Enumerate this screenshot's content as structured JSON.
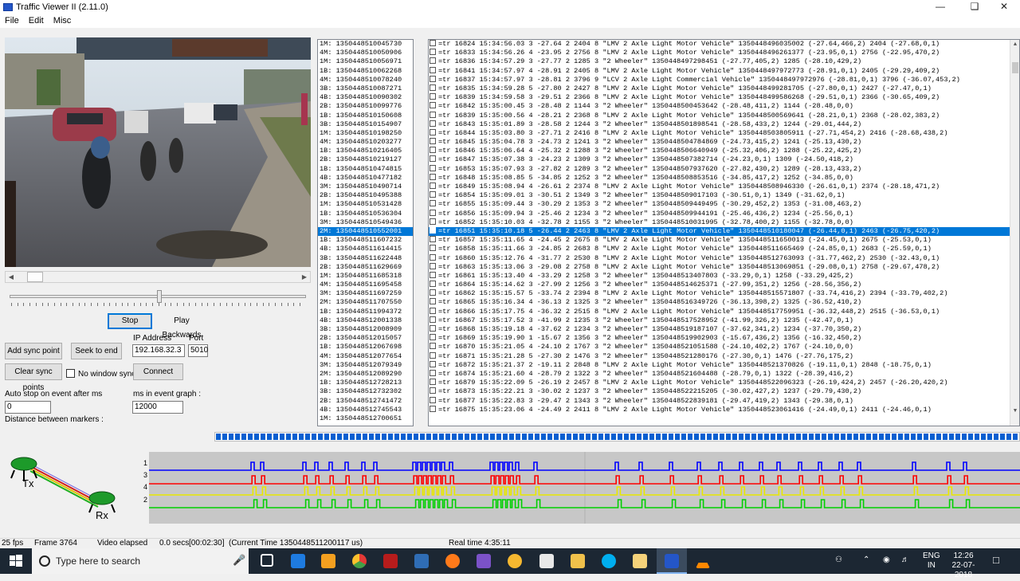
{
  "window": {
    "title": "Traffic Viewer II (2.11.0)",
    "min_icon": "minimize-icon",
    "max_icon": "maximize-icon",
    "close_icon": "close-icon"
  },
  "menu": [
    "File",
    "Edit",
    "Misc"
  ],
  "controls": {
    "stop": "Stop",
    "play_backwards": "Play Backwards",
    "add_sync": "Add sync point",
    "seek_end": "Seek to end",
    "clear_sync": "Clear sync points",
    "no_window_sync": "No window sync",
    "connect": "Connect",
    "ip_label": "IP Address",
    "ip_value": "192.168.32.3",
    "port_label": "Port",
    "port_value": "5010",
    "auto_stop_label": "Auto stop on event after ms",
    "auto_stop_value": "0",
    "ms_graph_label": "ms in event graph :",
    "ms_graph_value": "12000",
    "distance_label": "Distance between markers :"
  },
  "timestamps": [
    "1M:  1350448510045730",
    "4M:  1350448510050906",
    "1M:  1350448510056971",
    "1B:  1350448510062268",
    "4M:  1350448510078240",
    "3B:  1350448510087271",
    "4B:  1350448510090302",
    "2B:  1350448510099776",
    "1B:  1350448510150608",
    "3B:  1350448510154907",
    "1M:  1350448510198250",
    "4M:  1350448510203277",
    "1B:  1350448510216405",
    "2B:  1350448510219127",
    "1B:  1350448510474815",
    "4B:  1350448510477182",
    "3M:  1350448510490714",
    "2B:  1350448510495388",
    "1M:  1350448510531428",
    "1B:  1350448510536304",
    "3M:  1350448510549436",
    "2M:  1350448510552001",
    "1B:  1350448511607232",
    "4B:  1350448511614415",
    "3B:  1350448511622448",
    "2B:  1350448511629669",
    "1M:  1350448511685318",
    "4M:  1350448511695458",
    "3M:  1350448511697259",
    "2M:  1350448511707550",
    "1B:  1350448511994372",
    "4B:  1350448512001338",
    "3B:  1350448512008909",
    "2B:  1350448512015057",
    "1B:  1350448512067698",
    "4M:  1350448512077654",
    "3M:  1350448512079349",
    "2M:  1350448512089290",
    "1B:  1350448512728213",
    "3B:  1350448512732302",
    "2B:  1350448512741472",
    "4B:  1350448512745543",
    "1M:  1350448512700651"
  ],
  "timestamps_selected": 21,
  "events": [
    "=tr 16824 15:34:56.03 3 -27.64 2 2404 8 \"LMV 2 Axle Light Motor Vehicle\" 1350448496035002 (-27.64,466,2) 2404 (-27.68,0,1)",
    "=tr 16833 15:34:56.26 4 -23.95 2 2756 8 \"LMV 2 Axle Light Motor Vehicle\" 1350448496261377 (-23.95,0,1) 2756 (-22.95,470,2)",
    "=tr 16836 15:34:57.29 3 -27.77 2 1285 3 \"2 Wheeler\" 1350448497298451 (-27.77,405,2) 1285 (-28.10,429,2)",
    "=tr 16841 15:34:57.97 4 -28.91 2 2405 8 \"LMV 2 Axle Light Motor Vehicle\" 1350448497972773 (-28.91,0,1) 2405 (-29.29,409,2)",
    "=tr 16837 15:34:57.97 3 -28.81 2 3796 9 \"LCV 2 Axle Light Commercial Vehicle\" 1350448497972976 (-28.81,0,1) 3796 (-36.07,453,2)",
    "=tr 16835 15:34:59.28 5 -27.80 2 2427 8 \"LMV 2 Axle Light Motor Vehicle\" 1350448499281705 (-27.80,0,1) 2427 (-27.47,0,1)",
    "=tr 16839 15:34:59.58 3 -29.51 2 2366 8 \"LMV 2 Axle Light Motor Vehicle\" 1350448499586268 (-29.51,0,1) 2366 (-30.65,409,2)",
    "=tr 16842 15:35:00.45 3 -28.48 2 1144 3 \"2 Wheeler\" 1350448500453642 (-28.48,411,2) 1144 (-28.48,0,0)",
    "=tr 16839 15:35:00.56 4 -28.21 2 2368 8 \"LMV 2 Axle Light Motor Vehicle\" 1350448500569641 (-28.21,0,1) 2368 (-28.02,383,2)",
    "=tr 16843 15:35:01.89 3 -28.58 2 1244 3 \"2 Wheeler\" 1350448501898541 (-28.58,433,2) 1244 (-29.01,444,2)",
    "=tr 16844 15:35:03.80 3 -27.71 2 2416 8 \"LMV 2 Axle Light Motor Vehicle\" 1350448503805911 (-27.71,454,2) 2416 (-28.68,438,2)",
    "=tr 16845 15:35:04.78 3 -24.73 2 1241 3 \"2 Wheeler\" 1350448504784869 (-24.73,415,2) 1241 (-25.13,430,2)",
    "=tr 16846 15:35:06.64 4 -25.32 2 1288 3 \"2 Wheeler\" 1350448506640949 (-25.32,406,2) 1288 (-25.22,425,2)",
    "=tr 16847 15:35:07.38 3 -24.23 2 1309 3 \"2 Wheeler\" 1350448507382714 (-24.23,0,1) 1309 (-24.50,418,2)",
    "=tr 16853 15:35:07.93 3 -27.82 2 1289 3 \"2 Wheeler\" 1350448507937620 (-27.82,430,2) 1289 (-28.13,433,2)",
    "=tr 16848 15:35:08.85 5 -34.85 2 1252 3 \"2 Wheeler\" 1350448508853516 (-34.85,417,2) 1252 (-34.85,0,0)",
    "=tr 16849 15:35:08.94 4 -26.61 2 2374 8 \"LMV 2 Axle Light Motor Vehicle\" 1350448508946330 (-26.61,0,1) 2374 (-28.18,471,2)",
    "=tr 16854 15:35:09.01 3 -30.51 2 1349 3 \"2 Wheeler\" 1350448509017103 (-30.51,0,1) 1349 (-31.62,0,1)",
    "=tr 16855 15:35:09.44 3 -30.29 2 1353 3 \"2 Wheeler\" 1350448509449495 (-30.29,452,2) 1353 (-31.08,463,2)",
    "=tr 16856 15:35:09.94 3 -25.46 2 1234 3 \"2 Wheeler\" 1350448509944191 (-25.46,436,2) 1234 (-25.56,0,1)",
    "=tr 16852 15:35:10.03 4 -32.78 2 1155 3 \"2 Wheeler\" 1350448510031995 (-32.78,400,2) 1155 (-32.78,0,0)",
    "=tr 16851 15:35:10.18 5 -26.44 2 2463 8 \"LMV 2 Axle Light Motor Vehicle\" 1350448510180047 (-26.44,0,1) 2463 (-26.75,420,2)",
    "=tr 16857 15:35:11.65 4 -24.45 2 2675 8 \"LMV 2 Axle Light Motor Vehicle\" 1350448511650013 (-24.45,0,1) 2675 (-25.53,0,1)",
    "=tr 16858 15:35:11.66 3 -24.85 2 2683 8 \"LMV 2 Axle Light Motor Vehicle\" 1350448511665469 (-24.85,0,1) 2683 (-25.59,0,1)",
    "=tr 16860 15:35:12.76 4 -31.77 2 2530 8 \"LMV 2 Axle Light Motor Vehicle\" 1350448512763093 (-31.77,462,2) 2530 (-32.43,0,1)",
    "=tr 16863 15:35:13.06 3 -29.08 2 2758 8 \"LMV 2 Axle Light Motor Vehicle\" 1350448513069851 (-29.08,0,1) 2758 (-29.67,478,2)",
    "=tr 16861 15:35:13.40 4 -33.29 2 1258 3 \"2 Wheeler\" 1350448513407803 (-33.29,0,1) 1258 (-33.29,425,2)",
    "=tr 16864 15:35:14.62 3 -27.99 2 1256 3 \"2 Wheeler\" 1350448514625371 (-27.99,351,2) 1256 (-28.56,356,2)",
    "=tr 16862 15:35:15.57 5 -33.74 2 2394 8 \"LMV 2 Axle Light Motor Vehicle\" 1350448515571807 (-33.74,416,2) 2394 (-33.79,402,2)",
    "=tr 16865 15:35:16.34 4 -36.13 2 1325 3 \"2 Wheeler\" 1350448516349726 (-36.13,398,2) 1325 (-36.52,410,2)",
    "=tr 16866 15:35:17.75 4 -36.32 2 2515 8 \"LMV 2 Axle Light Motor Vehicle\" 1350448517759951 (-36.32,448,2) 2515 (-36.53,0,1)",
    "=tr 16867 15:35:17.52 3 -41.99 2 1235 3 \"2 Wheeler\" 1350448517528952 (-41.99,326,2) 1235 (-42.47,0,1)",
    "=tr 16868 15:35:19.18 4 -37.62 2 1234 3 \"2 Wheeler\" 1350448519187107 (-37.62,341,2) 1234 (-37.70,350,2)",
    "=tr 16869 15:35:19.90 1 -15.67 2 1356 3 \"2 Wheeler\" 1350448519902903 (-15.67,436,2) 1356 (-16.32,450,2)",
    "=tr 16870 15:35:21.05 4 -24.10 2 1767 3 \"2 Wheeler\" 1350448521051588 (-24.10,402,2) 1767 (-24.10,0,0)",
    "=tr 16871 15:35:21.28 5 -27.30 2 1476 3 \"2 Wheeler\" 1350448521280176 (-27.30,0,1) 1476 (-27.76,175,2)",
    "=tr 16872 15:35:21.37 2 -19.11 2 2848 8 \"LMV 2 Axle Light Motor Vehicle\" 1350448521370826 (-19.11,0,1) 2848 (-18.75,0,1)",
    "=tr 16874 15:35:21.60 4 -28.79 2 1322 3 \"2 Wheeler\" 1350448521604488 (-28.79,0,1) 1322 (-28.39,416,2)",
    "=tr 16879 15:35:22.09 5 -26.19 2 2457 8 \"LMV 2 Axle Light Motor Vehicle\" 1350448522096323 (-26.19,424,2) 2457 (-26.20,420,2)",
    "=tr 16873 15:35:22.21 3 -30.02 2 1237 3 \"2 Wheeler\" 1350448522215205 (-30.02,427,2) 1237 (-29.79,430,2)",
    "=tr 16877 15:35:22.83 3 -29.47 2 1343 3 \"2 Wheeler\" 1350448522839181 (-29.47,419,2) 1343 (-29.38,0,1)",
    "=tr 16875 15:35:23.06 4 -24.49 2 2411 8 \"LMV 2 Axle Light Motor Vehicle\" 1350448523061416 (-24.49,0,1) 2411 (-24.46,0,1)"
  ],
  "events_selected": 21,
  "graph": {
    "channel_labels": [
      "1",
      "3",
      "4",
      "2"
    ],
    "colors": {
      "1": "#0000ff",
      "3": "#ff0000",
      "4": "#e8e800",
      "2": "#00d000"
    },
    "diagram": {
      "tx_label": "Tx",
      "rx_label": "Rx"
    }
  },
  "status": {
    "fps": "25 fps",
    "frame": "Frame 3764",
    "elapsed_label": "Video elapsed",
    "elapsed_value": "0.0 secs",
    "elapsed_clock": "[00:02:30]",
    "current_time": "(Current Time 1350448511200117 us)",
    "real_time": "Real time 4:35:11"
  },
  "taskbar": {
    "search_placeholder": "Type here to search",
    "lang": "ENG",
    "lang2": "IN",
    "time": "12:26",
    "date": "22-07-2018"
  }
}
